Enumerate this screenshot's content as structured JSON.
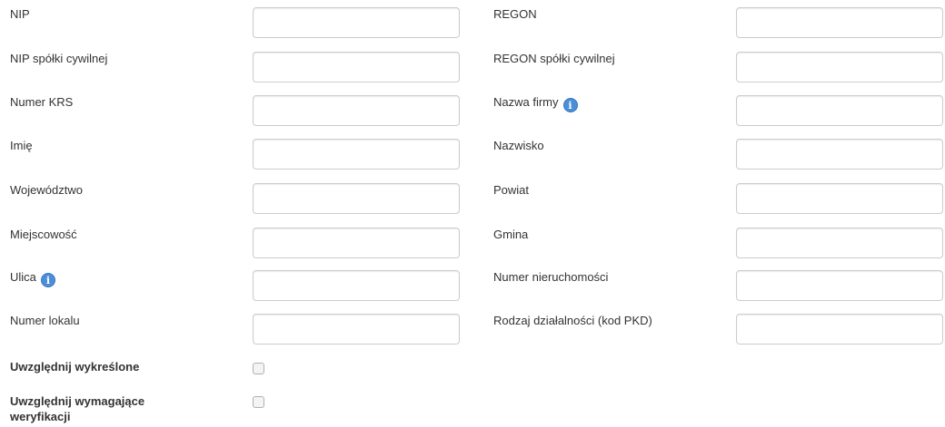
{
  "fields": [
    {
      "left": "NIP",
      "right": "REGON"
    },
    {
      "left": "NIP spółki cywilnej",
      "right": "REGON spółki cywilnej"
    },
    {
      "left": "Numer KRS",
      "right": "Nazwa firmy"
    },
    {
      "left": "Imię",
      "right": "Nazwisko"
    },
    {
      "left": "Województwo",
      "right": "Powiat"
    },
    {
      "left": "Miejscowość",
      "right": "Gmina"
    },
    {
      "left": "Ulica",
      "right": "Numer nieruchomości"
    },
    {
      "left": "Numer lokalu",
      "right": "Rodzaj działalności (kod PKD)"
    }
  ],
  "info_icon_glyph": "i",
  "info_icon_color": "#4a8fd8",
  "checkboxes": [
    {
      "label": "Uwzględnij wykreślone",
      "checked": false
    },
    {
      "label": "Uwzględnij wymagające weryfikacji",
      "checked": false
    }
  ]
}
